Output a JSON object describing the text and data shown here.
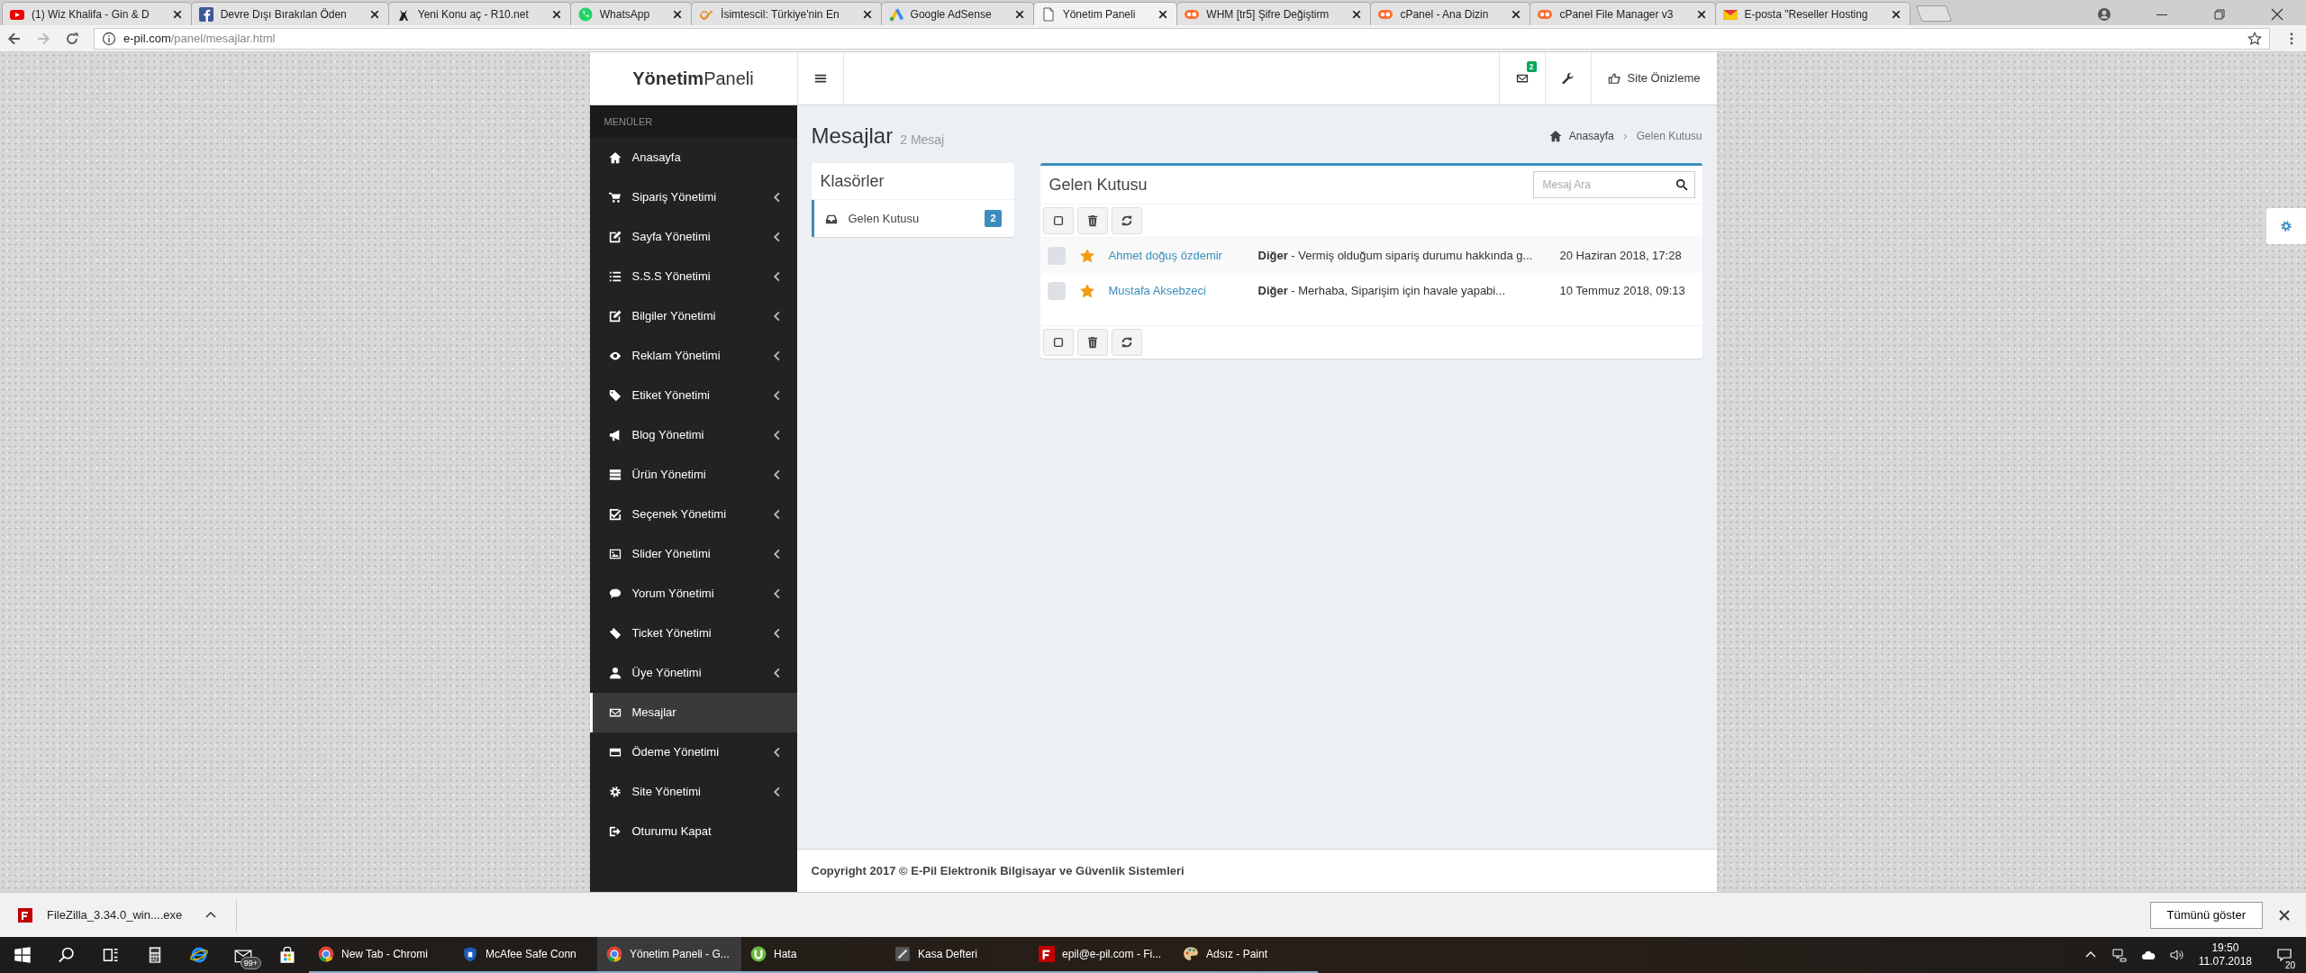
{
  "browser": {
    "tabs": [
      {
        "title": "(1) Wiz Khalifa - Gin & D",
        "kind": "video",
        "selected": false
      },
      {
        "title": "Devre Dışı Bırakılan Öden",
        "kind": "social",
        "selected": false
      },
      {
        "title": "Yeni Konu aç - R10.net",
        "kind": "figure",
        "selected": false
      },
      {
        "title": "WhatsApp",
        "kind": "chat",
        "selected": false
      },
      {
        "title": "İsimtescil: Türkiye'nin En",
        "kind": "tick",
        "selected": false
      },
      {
        "title": "Google AdSense",
        "kind": "triangle",
        "selected": false
      },
      {
        "title": "Yönetim Paneli",
        "kind": "page",
        "selected": true
      },
      {
        "title": "WHM [tr5] Şifre Değiştirm",
        "kind": "cpanel",
        "selected": false
      },
      {
        "title": "cPanel - Ana Dizin",
        "kind": "cpanel",
        "selected": false
      },
      {
        "title": "cPanel File Manager v3",
        "kind": "cpanel",
        "selected": false
      },
      {
        "title": "E-posta \"Reseller Hosting",
        "kind": "mail",
        "selected": false
      }
    ],
    "address": {
      "host": "e-pil.com",
      "path": "/panel/mesajlar.html"
    }
  },
  "panel": {
    "brand": "**Yönetim**Paneli",
    "header": {
      "mail_count": "2",
      "preview": "Site Önizleme"
    },
    "sidebar": {
      "heading": "MENÜLER",
      "items": [
        {
          "label": "Anasayfa",
          "kind": "house",
          "expandable": false,
          "selected": false
        },
        {
          "label": "Sipariş Yönetimi",
          "kind": "cart",
          "expandable": true,
          "selected": false
        },
        {
          "label": "Sayfa Yönetimi",
          "kind": "pencil",
          "expandable": true,
          "selected": false
        },
        {
          "label": "S.S.S Yönetimi",
          "kind": "list",
          "expandable": true,
          "selected": false
        },
        {
          "label": "Bilgiler Yönetimi",
          "kind": "pencil",
          "expandable": true,
          "selected": false
        },
        {
          "label": "Reklam Yönetimi",
          "kind": "eye",
          "expandable": true,
          "selected": false
        },
        {
          "label": "Etiket Yönetimi",
          "kind": "tag",
          "expandable": true,
          "selected": false
        },
        {
          "label": "Blog Yönetimi",
          "kind": "megaphone",
          "expandable": true,
          "selected": false
        },
        {
          "label": "Ürün Yönetimi",
          "kind": "stack",
          "expandable": true,
          "selected": false
        },
        {
          "label": "Seçenek Yönetimi",
          "kind": "check-square",
          "expandable": true,
          "selected": false
        },
        {
          "label": "Slider Yönetimi",
          "kind": "image",
          "expandable": true,
          "selected": false
        },
        {
          "label": "Yorum Yönetimi",
          "kind": "speech-bubble",
          "expandable": true,
          "selected": false
        },
        {
          "label": "Ticket Yönetimi",
          "kind": "ticket",
          "expandable": true,
          "selected": false
        },
        {
          "label": "Üye Yönetimi",
          "kind": "person",
          "expandable": true,
          "selected": false
        },
        {
          "label": "Mesajlar",
          "kind": "envelope",
          "expandable": false,
          "selected": true
        },
        {
          "label": "Ödeme Yönetimi",
          "kind": "card",
          "expandable": true,
          "selected": false
        },
        {
          "label": "Site Yönetimi",
          "kind": "gear",
          "expandable": true,
          "selected": false
        },
        {
          "label": "Oturumu Kapat",
          "kind": "exit-arrow",
          "expandable": false,
          "selected": false
        }
      ]
    },
    "content": {
      "title": "Mesajlar",
      "subtitle": "2 Mesaj",
      "breadcrumb": [
        "Anasayfa",
        "Gelen Kutusu"
      ],
      "folders": {
        "title": "Klasörler",
        "items": [
          {
            "label": "Gelen Kutusu",
            "count": "2",
            "selected": true
          }
        ]
      },
      "inbox": {
        "title": "Gelen Kutusu",
        "search_placeholder": "Mesaj Ara",
        "messages": [
          {
            "sender": "Ahmet doğuş özdemir",
            "subject": "**Diğer** - Vermiş olduğum sipariş durumu hakkında g...",
            "date": "20 Haziran 2018, 17:28",
            "starred": true,
            "checked": false
          },
          {
            "sender": "Mustafa Aksebzeci",
            "subject": "**Diğer** - Merhaba, Siparişim için havale yapabi...",
            "date": "10 Temmuz 2018, 09:13",
            "starred": true,
            "checked": false
          }
        ]
      }
    },
    "footer": "Copyright 2017 © E-Pil Elektronik Bilgisayar ve Güvenlik Sistemleri"
  },
  "download_bar": {
    "file": "FileZilla_3.34.0_win....exe",
    "show_all": "Tümünü göster"
  },
  "taskbar": {
    "mail_badge": "99+",
    "apps": [
      {
        "label": "New Tab - Chromi",
        "kind": "browser",
        "active": false
      },
      {
        "label": "McAfee Safe Conn",
        "kind": "shield",
        "active": false
      },
      {
        "label": "Yönetim Paneli - G...",
        "kind": "browser",
        "active": true
      },
      {
        "label": "Hata",
        "kind": "green-circle",
        "active": false
      },
      {
        "label": "Kasa Defteri",
        "kind": "dark-app",
        "active": false
      },
      {
        "label": "epil@e-pil.com - Fi...",
        "kind": "red-app",
        "active": false
      },
      {
        "label": "Adsız - Paint",
        "kind": "palette",
        "active": false
      }
    ],
    "time": "19:50",
    "date": "11.07.2018",
    "notifications": "20"
  }
}
